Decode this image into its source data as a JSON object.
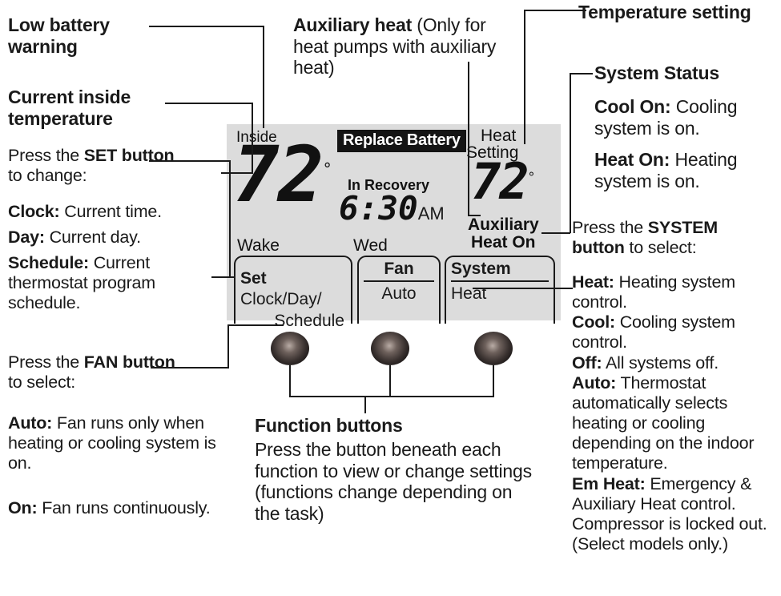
{
  "annotations": {
    "low_battery": {
      "bold": "Low battery warning"
    },
    "current_inside": {
      "bold": "Current inside temperature"
    },
    "press_set": {
      "pre": "Press the ",
      "bold": "SET button",
      "post": " to change:"
    },
    "clock": {
      "bold": "Clock:",
      "rest": " Current time."
    },
    "day": {
      "bold": "Day:",
      "rest": " Current day."
    },
    "schedule": {
      "bold": "Schedule:",
      "rest": " Current thermostat program schedule."
    },
    "press_fan": {
      "pre": "Press the ",
      "bold": "FAN button",
      "post": " to select:"
    },
    "fan_auto": {
      "bold": "Auto:",
      "rest": " Fan runs only when heating or cooling system is on."
    },
    "fan_on": {
      "bold": "On:",
      "rest": " Fan runs continuously."
    },
    "auxiliary_heat": {
      "bold": "Auxiliary heat",
      "rest": " (Only for heat pumps with auxiliary heat)"
    },
    "temperature_setting": {
      "bold": "Temperature setting"
    },
    "system_status": {
      "bold": "System Status"
    },
    "cool_on": {
      "bold": "Cool On:",
      "rest": " Cooling system is on."
    },
    "heat_on": {
      "bold": "Heat On:",
      "rest": " Heating system is on."
    },
    "press_system": {
      "pre": "Press the ",
      "bold": "SYSTEM button",
      "post": " to select:"
    },
    "sys_heat": {
      "bold": "Heat:",
      "rest": " Heating system control."
    },
    "sys_cool": {
      "bold": "Cool:",
      "rest": " Cooling system control."
    },
    "sys_off": {
      "bold": "Off:",
      "rest": " All systems off."
    },
    "sys_auto": {
      "bold": "Auto:",
      "rest": " Thermostat automatically selects heating or cooling depending on the indoor temperature."
    },
    "sys_em_heat": {
      "bold": "Em Heat:",
      "rest": " Emergency & Auxiliary Heat control. Compressor is locked out. (Select models only.)"
    },
    "function_buttons": {
      "title": "Function buttons",
      "body": "Press the button beneath each function to view or change settings (functions change depending on the task)"
    }
  },
  "lcd": {
    "inside_label": "Inside",
    "inside_temp": "72",
    "degree": "°",
    "replace_battery": "Replace Battery",
    "in_recovery": "In Recovery",
    "clock_time": "6:30",
    "clock_meridiem": "AM",
    "period_label": "Wake",
    "day_label": "Wed",
    "heat_setting_line1": "Heat",
    "heat_setting_line2": "Setting",
    "heat_setting_temp": "72",
    "aux_line1": "Auxiliary",
    "aux_line2": "Heat On",
    "boxes": [
      {
        "header_bold": "Set",
        "header_rest": " Clock/Day/",
        "value": "Schedule",
        "style": "plain"
      },
      {
        "header_bold": "Fan",
        "value": "Auto",
        "style": "ruled"
      },
      {
        "header_bold": "System",
        "value": "Heat",
        "style": "ruled"
      }
    ]
  },
  "colors": {
    "lcd_background": "#dcdcdc",
    "ink": "#1a1a1a",
    "badge_background": "#141414",
    "badge_text": "#ffffff"
  }
}
